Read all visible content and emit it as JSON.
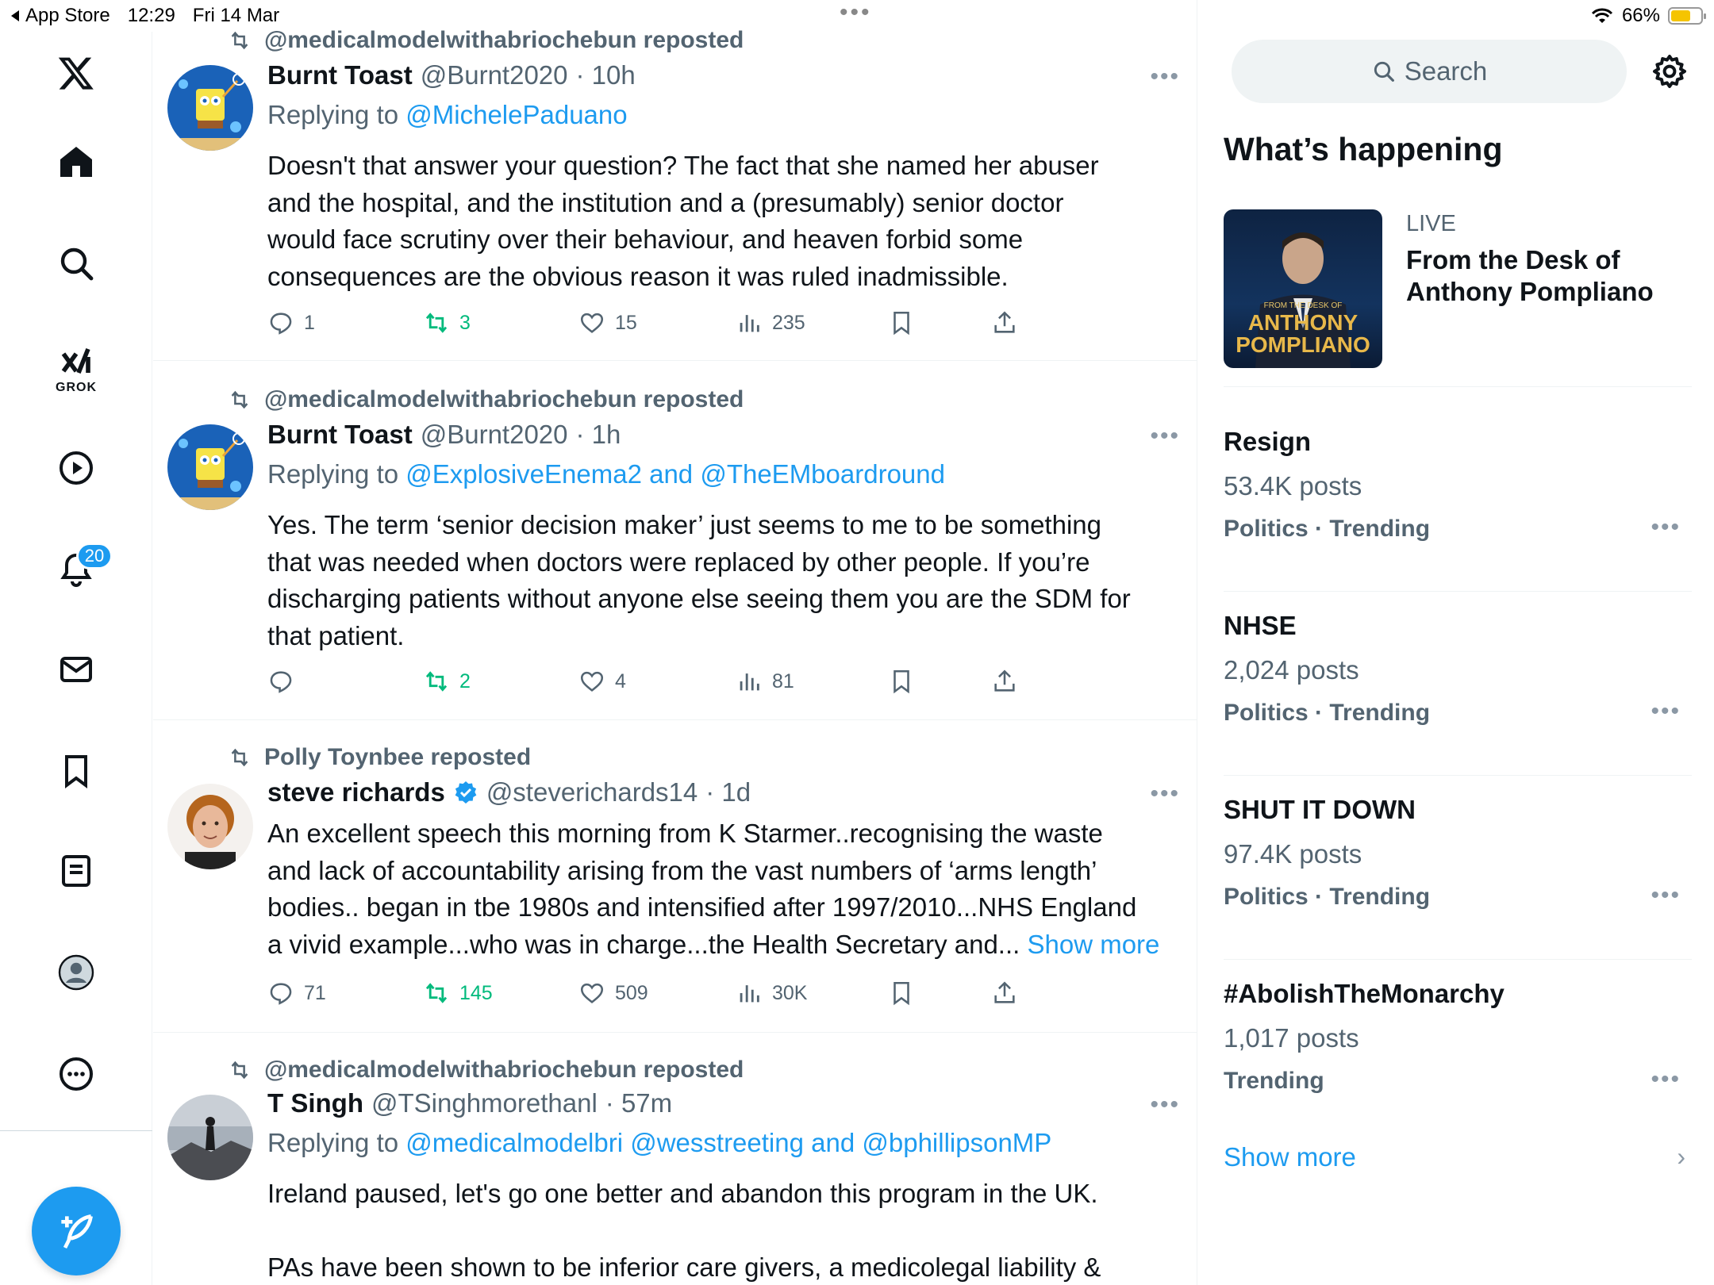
{
  "status_bar": {
    "back_app": "App Store",
    "time": "12:29",
    "date": "Fri 14 Mar",
    "battery": "66%",
    "battery_level": 0.66
  },
  "nav": {
    "grok_label": "GROK",
    "notifications_badge": "20"
  },
  "tweets": [
    {
      "reposter": "@medicalmodelwithabriochebun reposted",
      "name": "Burnt Toast",
      "handle": "@Burnt2020",
      "time": "· 10h",
      "reply_prefix": "Replying to",
      "reply_to": "@MichelePaduano",
      "body_lines": [
        "Doesn't that answer your question? The fact that she named her abuser",
        "and the hospital, and the institution and a (presumably) senior doctor",
        "would face scrutiny over their behaviour, and heaven forbid some",
        "consequences are the obvious reason it was ruled inadmissible."
      ],
      "replies": "1",
      "reposts": "3",
      "likes": "15",
      "views": "235"
    },
    {
      "reposter": "@medicalmodelwithabriochebun reposted",
      "name": "Burnt Toast",
      "handle": "@Burnt2020",
      "time": "· 1h",
      "reply_prefix": "Replying to",
      "reply_to": "@ExplosiveEnema2 and @TheEMboardround",
      "body_lines": [
        "Yes. The term ‘senior decision maker’ just seems to me to be something",
        "that was needed when doctors were replaced by other people. If you’re",
        "discharging patients without anyone else seeing them you are the SDM for",
        "that patient."
      ],
      "replies": "",
      "reposts": "2",
      "likes": "4",
      "views": "81"
    },
    {
      "reposter": "Polly Toynbee reposted",
      "name": "steve richards",
      "handle": "@steverichards14",
      "time": "· 1d",
      "body_lines": [
        "An excellent speech this morning from K Starmer..recognising the waste",
        "and lack of accountability arising from the vast numbers of ‘arms length’",
        "bodies.. began in tbe 1980s and intensified after 1997/2010...NHS England",
        "a vivid example...who was in charge...the Health Secretary and..."
      ],
      "show_more": "Show more",
      "replies": "71",
      "reposts": "145",
      "likes": "509",
      "views": "30K"
    },
    {
      "reposter": "@medicalmodelwithabriochebun reposted",
      "name": "T Singh",
      "handle": "@TSinghmorethanl",
      "time": "· 57m",
      "reply_prefix": "Replying to",
      "reply_to": "@medicalmodelbri @wesstreeting and @bphillipsonMP",
      "body_lines": [
        "Ireland paused, let's go one better and abandon this program in the UK.",
        "",
        "PAs have been shown to be inferior care givers, a medicolegal liability &"
      ]
    }
  ],
  "right": {
    "search_placeholder": "Search",
    "whats_happening": "What’s happening",
    "live": {
      "label": "LIVE",
      "title": "From the Desk of Anthony Pompliano",
      "image_small": "FROM THE DESK OF",
      "image_line1": "ANTHONY",
      "image_line2": "POMPLIANO"
    },
    "trends": [
      {
        "name": "Resign",
        "count": "53.4K posts",
        "category": "Politics · Trending"
      },
      {
        "name": "NHSE",
        "count": "2,024 posts",
        "category": "Politics · Trending"
      },
      {
        "name": "SHUT IT DOWN",
        "count": "97.4K posts",
        "category": "Politics · Trending"
      },
      {
        "name": "#AbolishTheMonarchy",
        "count": "1,017 posts",
        "category": "Trending"
      }
    ],
    "show_more": "Show more"
  },
  "colors": {
    "accent": "#1d9bf0",
    "repost_green": "#00ba7c",
    "secondary_text": "#536471"
  }
}
